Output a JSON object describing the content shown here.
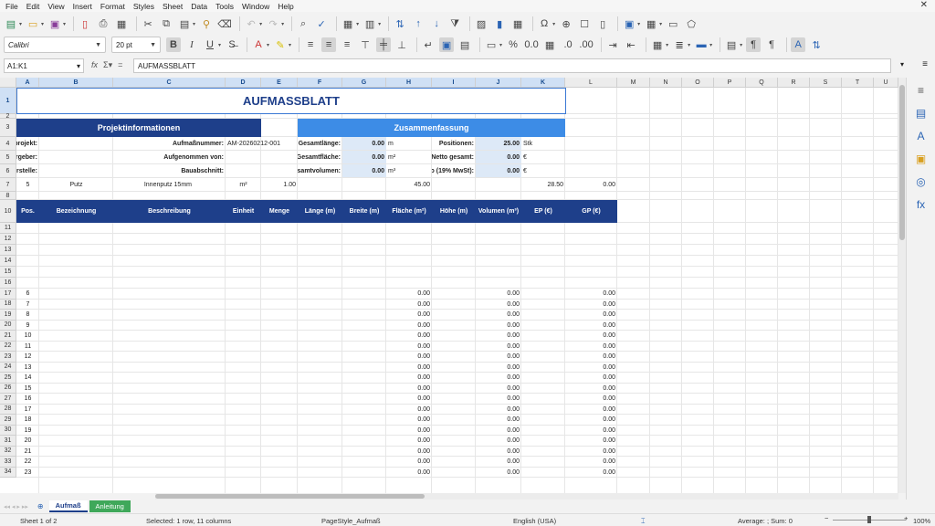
{
  "menubar": {
    "items": [
      "File",
      "Edit",
      "View",
      "Insert",
      "Format",
      "Styles",
      "Sheet",
      "Data",
      "Tools",
      "Window",
      "Help"
    ],
    "close_glyph": "✕"
  },
  "toolbar2": {
    "font_name": "Calibri",
    "font_size": "20 pt",
    "bold": "B",
    "italic": "I",
    "underline": "U"
  },
  "formula_bar": {
    "name_box": "A1:K1",
    "content": "AUFMASSBLATT"
  },
  "columns": [
    "A",
    "B",
    "C",
    "D",
    "E",
    "F",
    "G",
    "H",
    "I",
    "J",
    "K",
    "L",
    "M",
    "N",
    "O",
    "P",
    "Q",
    "R",
    "S",
    "T",
    "U"
  ],
  "rows": [
    "1",
    "2",
    "3",
    "4",
    "5",
    "6",
    "7",
    "8",
    "10",
    "11",
    "12",
    "13",
    "14",
    "15",
    "16",
    "17",
    "18",
    "19",
    "20",
    "21",
    "22",
    "23",
    "24",
    "25",
    "26",
    "27",
    "28",
    "29",
    "30",
    "31",
    "32",
    "33",
    "34"
  ],
  "sheet": {
    "title": "AUFMASSBLATT",
    "projekt_header": "Projektinformationen",
    "summary_header": "Zusammenfassung",
    "left_labels": [
      "projekt:",
      "rgeber:",
      "rstelle:"
    ],
    "mid_labels": [
      "Aufmaßnummer:",
      "Aufgenommen von:",
      "Bauabschnitt:"
    ],
    "aufmass_nr": "AM-20260212-001",
    "summary_labels": [
      "Gesamtlänge:",
      "Gesamtfläche:",
      "Gesamtvolumen:"
    ],
    "summary_values": [
      "0.00",
      "0.00",
      "0.00"
    ],
    "summary_units": [
      "m",
      "m²",
      "m³"
    ],
    "right_labels": [
      "Positionen:",
      "Netto gesamt:",
      "o (19% MwSt):"
    ],
    "right_values": [
      "25.00",
      "0.00",
      "0.00"
    ],
    "right_units": [
      "Stk",
      "€",
      "€"
    ],
    "row7": {
      "pos": "5",
      "bezeichnung": "Putz",
      "beschreibung": "Innenputz 15mm",
      "einheit": "m²",
      "menge": "1.00",
      "flaeche": "45.00",
      "ep": "28.50",
      "gp": "0.00"
    },
    "table_headers": [
      "Pos.",
      "Bezeichnung",
      "Beschreibung",
      "Einheit",
      "Menge",
      "Länge (m)",
      "Breite (m)",
      "Fläche (m²)",
      "Höhe (m)",
      "Volumen (m³)",
      "EP (€)",
      "GP (€)"
    ],
    "data_rows": [
      {
        "row": "17",
        "pos": "6"
      },
      {
        "row": "18",
        "pos": "7"
      },
      {
        "row": "19",
        "pos": "8"
      },
      {
        "row": "20",
        "pos": "9"
      },
      {
        "row": "21",
        "pos": "10"
      },
      {
        "row": "22",
        "pos": "11"
      },
      {
        "row": "23",
        "pos": "12"
      },
      {
        "row": "24",
        "pos": "13"
      },
      {
        "row": "25",
        "pos": "14"
      },
      {
        "row": "26",
        "pos": "15"
      },
      {
        "row": "27",
        "pos": "16"
      },
      {
        "row": "28",
        "pos": "17"
      },
      {
        "row": "29",
        "pos": "18"
      },
      {
        "row": "30",
        "pos": "19"
      },
      {
        "row": "31",
        "pos": "20"
      },
      {
        "row": "32",
        "pos": "21"
      },
      {
        "row": "33",
        "pos": "22"
      },
      {
        "row": "34",
        "pos": "23"
      }
    ],
    "zero": "0.00"
  },
  "tabs": [
    {
      "label": "Aufmaß",
      "active": true
    },
    {
      "label": "Anleitung",
      "active": false
    }
  ],
  "status": {
    "sheet": "Sheet 1 of 2",
    "selection": "Selected: 1 row, 11 columns",
    "page_style": "PageStyle_Aufmaß",
    "language": "English (USA)",
    "summary": "Average: ; Sum: 0",
    "zoom": "100%"
  },
  "colors": {
    "header_navy": "#1e3f8a",
    "summary_blue": "#3d8ce6",
    "light_blue": "#dde9f7",
    "tab_green": "#3fa85a"
  }
}
